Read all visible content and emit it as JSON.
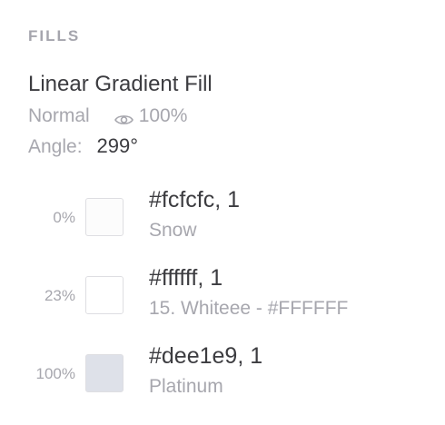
{
  "section": {
    "title": "FILLS"
  },
  "fill": {
    "type": "Linear Gradient Fill",
    "blend_mode": "Normal",
    "eye_icon": "eye-icon",
    "opacity": "100%",
    "angle_label": "Angle:",
    "angle_value": "299°"
  },
  "stops": [
    {
      "position": "0%",
      "color": "#fcfcfc",
      "hex_label": "#fcfcfc, 1",
      "name": "Snow"
    },
    {
      "position": "23%",
      "color": "#ffffff",
      "hex_label": "#ffffff, 1",
      "name": "15. Whiteee - #FFFFFF"
    },
    {
      "position": "100%",
      "color": "#dee1e9",
      "hex_label": "#dee1e9, 1",
      "name": "Platinum"
    }
  ]
}
